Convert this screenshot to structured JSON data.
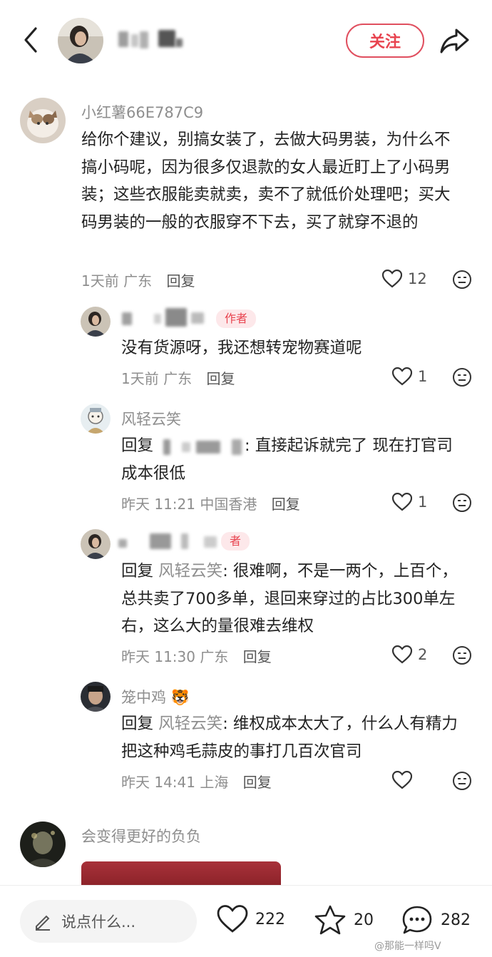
{
  "header": {
    "follow_label": "关注",
    "icons": [
      "back-arrow-icon",
      "share-icon"
    ]
  },
  "comments": [
    {
      "user": "小红薯66E787C9",
      "text": "给你个建议，别搞女装了，去做大码男装，为什么不搞小码呢，因为很多仅退款的女人最近盯上了小码男装；这些衣服能卖就卖，卖不了就低价处理吧；买大码男装的一般的衣服穿不下去，买了就穿不退的",
      "meta": "1天前 广东",
      "reply_label": "回复",
      "likes": "12"
    },
    {
      "tag": "作者",
      "text": "没有货源呀，我还想转宠物赛道呢",
      "meta": "1天前 广东",
      "reply_label": "回复",
      "likes": "1"
    },
    {
      "user": "风轻云笑",
      "reply_prefix": "回复",
      "text_tail": ": 直接起诉就完了 现在打官司成本很低",
      "meta": "昨天 11:21 中国香港",
      "reply_label": "回复",
      "likes": "1"
    },
    {
      "tag": "者",
      "reply_prefix": "回复",
      "reply_to": "风轻云笑",
      "text_tail": ": 很难啊，不是一两个，上百个，总共卖了700多单，退回来穿过的占比300单左右，这么大的量很难去维权",
      "meta": "昨天 11:30 广东",
      "reply_label": "回复",
      "likes": "2"
    },
    {
      "user": "笼中鸡",
      "user_emoji": "🐯",
      "reply_prefix": "回复",
      "reply_to": "风轻云笑",
      "text_tail": ": 维权成本太大了，什么人有精力把这种鸡毛蒜皮的事打几百次官司",
      "meta": "昨天 14:41 上海",
      "reply_label": "回复"
    },
    {
      "user": "会变得更好的负负"
    }
  ],
  "bottom_bar": {
    "input_placeholder": "说点什么...",
    "likes": "222",
    "stars": "20",
    "comments": "282"
  },
  "watermark": "@那能一样吗V"
}
